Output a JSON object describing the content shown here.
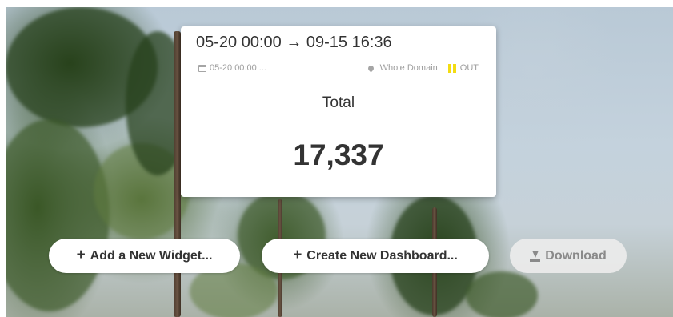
{
  "widget": {
    "title": "05-20 00:00 → 09-15 16:36",
    "date_short": "05-20 00:00 ...",
    "scope": "Whole Domain",
    "direction": "OUT",
    "label": "Total",
    "value": "17,337",
    "icons": {
      "date": "calendar-icon",
      "scope": "map-marker-icon",
      "direction": "in-out-icon"
    },
    "direction_color": "#f3dc12"
  },
  "actions": {
    "add_widget": "Add a New Widget...",
    "create_dashboard": "Create New Dashboard...",
    "download": "Download"
  },
  "background": {
    "description_icon": "pine-trees-photo"
  }
}
